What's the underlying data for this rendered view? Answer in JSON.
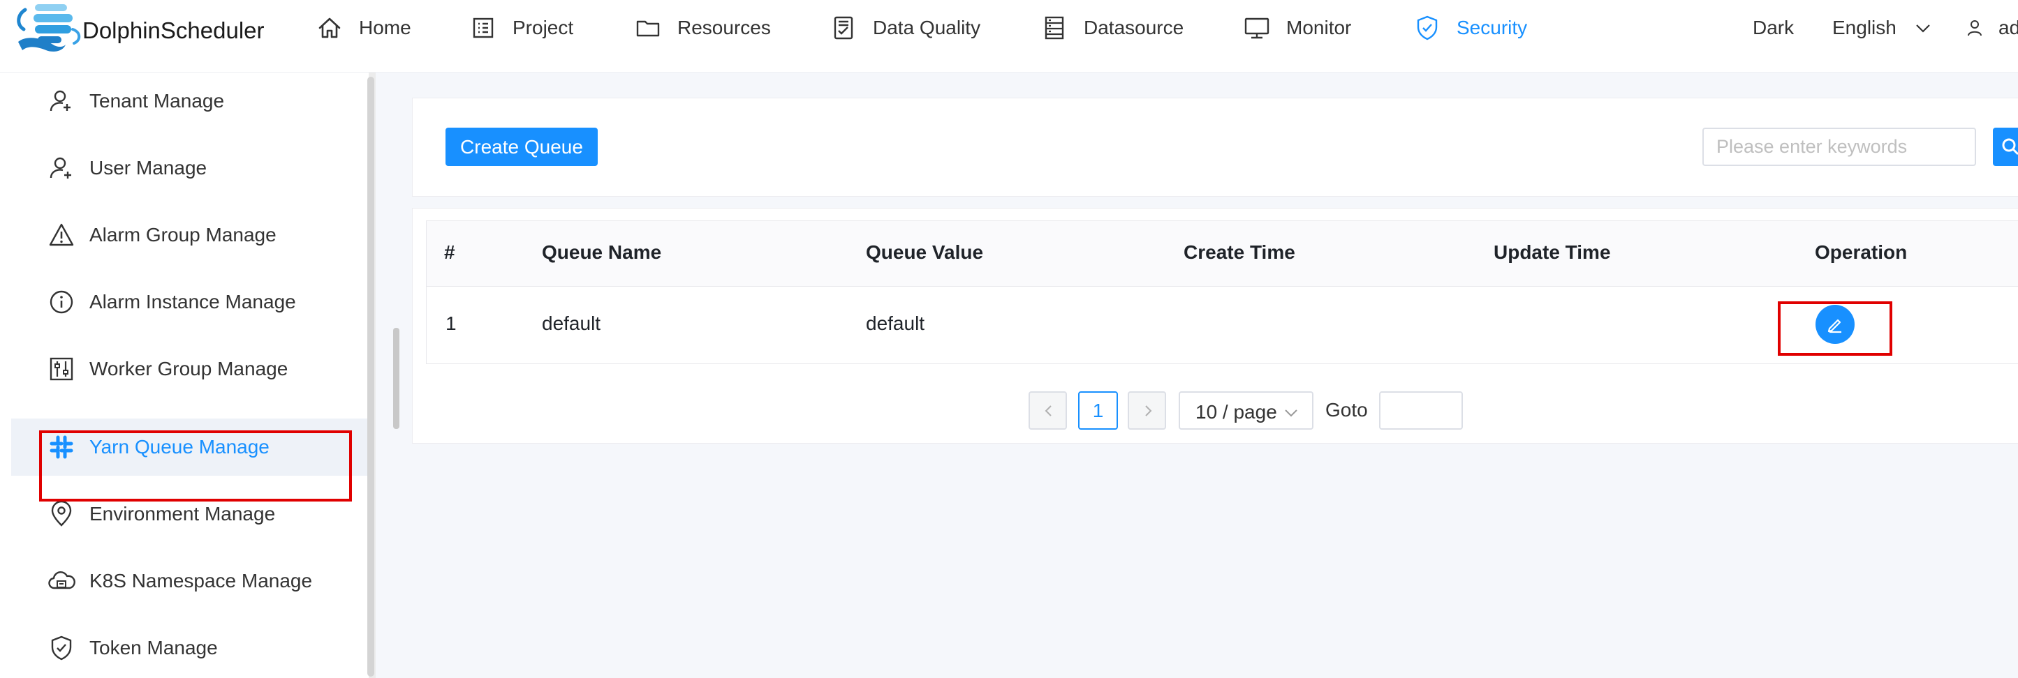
{
  "header": {
    "brand": "DolphinScheduler",
    "nav": [
      {
        "label": "Home",
        "icon": "home-icon"
      },
      {
        "label": "Project",
        "icon": "project-icon"
      },
      {
        "label": "Resources",
        "icon": "folder-icon"
      },
      {
        "label": "Data Quality",
        "icon": "data-quality-icon"
      },
      {
        "label": "Datasource",
        "icon": "datasource-icon"
      },
      {
        "label": "Monitor",
        "icon": "monitor-icon"
      },
      {
        "label": "Security",
        "icon": "shield-icon",
        "active": true
      }
    ],
    "theme_label": "Dark",
    "language_label": "English",
    "user_label": "ad"
  },
  "sidebar": {
    "items": [
      {
        "label": "Tenant Manage",
        "icon": "tenant-icon"
      },
      {
        "label": "User Manage",
        "icon": "user-add-icon"
      },
      {
        "label": "Alarm Group Manage",
        "icon": "warning-icon"
      },
      {
        "label": "Alarm Instance Manage",
        "icon": "info-icon"
      },
      {
        "label": "Worker Group Manage",
        "icon": "sliders-icon"
      },
      {
        "label": "Yarn Queue Manage",
        "icon": "slack-icon",
        "active": true
      },
      {
        "label": "Environment Manage",
        "icon": "location-icon"
      },
      {
        "label": "K8S Namespace Manage",
        "icon": "cloud-icon"
      },
      {
        "label": "Token Manage",
        "icon": "shield-check-icon"
      }
    ]
  },
  "toolbar": {
    "create_label": "Create Queue",
    "search_placeholder": "Please enter keywords"
  },
  "table": {
    "columns": [
      "#",
      "Queue Name",
      "Queue Value",
      "Create Time",
      "Update Time",
      "Operation"
    ],
    "rows": [
      {
        "index": "1",
        "queue_name": "default",
        "queue_value": "default",
        "create_time": "",
        "update_time": ""
      }
    ]
  },
  "pagination": {
    "current_page": "1",
    "page_size_label": "10 / page",
    "goto_label": "Goto"
  },
  "colors": {
    "accent": "#1890ff",
    "highlight": "#e00000"
  }
}
